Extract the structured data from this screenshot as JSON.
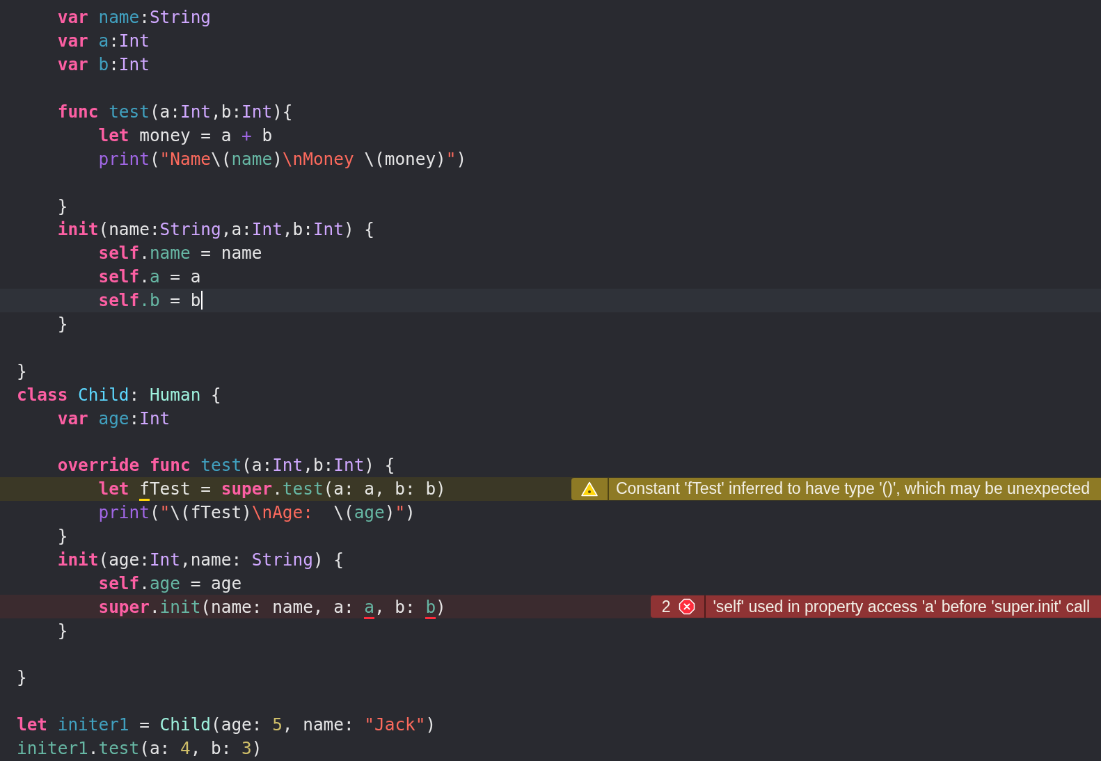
{
  "editor": {
    "lines": [
      {
        "kind": "code",
        "tokens": [
          {
            "text": "    var ",
            "kind": "keyword"
          },
          {
            "text": "name",
            "kind": "decl"
          },
          {
            "text": ":",
            "kind": "plain"
          },
          {
            "text": "String",
            "kind": "type"
          }
        ]
      },
      {
        "kind": "code",
        "tokens": [
          {
            "text": "    var ",
            "kind": "keyword"
          },
          {
            "text": "a",
            "kind": "decl"
          },
          {
            "text": ":",
            "kind": "plain"
          },
          {
            "text": "Int",
            "kind": "type"
          }
        ]
      },
      {
        "kind": "code",
        "tokens": [
          {
            "text": "    var ",
            "kind": "keyword"
          },
          {
            "text": "b",
            "kind": "decl"
          },
          {
            "text": ":",
            "kind": "plain"
          },
          {
            "text": "Int",
            "kind": "type"
          }
        ]
      },
      {
        "kind": "blank"
      },
      {
        "kind": "code",
        "tokens": [
          {
            "text": "    func ",
            "kind": "keyword"
          },
          {
            "text": "test",
            "kind": "decl"
          },
          {
            "text": "(a:",
            "kind": "plain"
          },
          {
            "text": "Int",
            "kind": "type"
          },
          {
            "text": ",b:",
            "kind": "plain"
          },
          {
            "text": "Int",
            "kind": "type"
          },
          {
            "text": "){",
            "kind": "plain"
          }
        ]
      },
      {
        "kind": "code",
        "tokens": [
          {
            "text": "        let",
            "kind": "keyword"
          },
          {
            "text": " money = a ",
            "kind": "plain"
          },
          {
            "text": "+",
            "kind": "operator"
          },
          {
            "text": " b",
            "kind": "plain"
          }
        ]
      },
      {
        "kind": "code",
        "tokens": [
          {
            "text": "        print",
            "kind": "sysfunc"
          },
          {
            "text": "(",
            "kind": "plain"
          },
          {
            "text": "\"Name",
            "kind": "string"
          },
          {
            "text": "\\(",
            "kind": "plain"
          },
          {
            "text": "name",
            "kind": "member"
          },
          {
            "text": ")",
            "kind": "plain"
          },
          {
            "text": "\\nMoney ",
            "kind": "string"
          },
          {
            "text": "\\(money)",
            "kind": "plain"
          },
          {
            "text": "\"",
            "kind": "string"
          },
          {
            "text": ")",
            "kind": "plain"
          }
        ]
      },
      {
        "kind": "blank"
      },
      {
        "kind": "code",
        "tokens": [
          {
            "text": "    }",
            "kind": "plain"
          }
        ]
      },
      {
        "kind": "code",
        "tokens": [
          {
            "text": "    init",
            "kind": "keyword"
          },
          {
            "text": "(name:",
            "kind": "plain"
          },
          {
            "text": "String",
            "kind": "type"
          },
          {
            "text": ",a:",
            "kind": "plain"
          },
          {
            "text": "Int",
            "kind": "type"
          },
          {
            "text": ",b:",
            "kind": "plain"
          },
          {
            "text": "Int",
            "kind": "type"
          },
          {
            "text": ") {",
            "kind": "plain"
          }
        ]
      },
      {
        "kind": "code",
        "tokens": [
          {
            "text": "        self",
            "kind": "keyword"
          },
          {
            "text": ".",
            "kind": "plain"
          },
          {
            "text": "name",
            "kind": "member"
          },
          {
            "text": " = name",
            "kind": "plain"
          }
        ]
      },
      {
        "kind": "code",
        "tokens": [
          {
            "text": "        self",
            "kind": "keyword"
          },
          {
            "text": ".",
            "kind": "plain"
          },
          {
            "text": "a",
            "kind": "member"
          },
          {
            "text": " = a",
            "kind": "plain"
          }
        ]
      },
      {
        "kind": "current",
        "cursor": true,
        "tokens": [
          {
            "text": "        self",
            "kind": "keyword"
          },
          {
            "text": ".b",
            "kind": "member"
          },
          {
            "text": " = b",
            "kind": "plain"
          }
        ]
      },
      {
        "kind": "code",
        "tokens": [
          {
            "text": "    }",
            "kind": "plain"
          }
        ]
      },
      {
        "kind": "blank"
      },
      {
        "kind": "code",
        "tokens": [
          {
            "text": "}",
            "kind": "plain"
          }
        ]
      },
      {
        "kind": "code",
        "tokens": [
          {
            "text": "class ",
            "kind": "keyword"
          },
          {
            "text": "Child",
            "kind": "classdecl"
          },
          {
            "text": ": ",
            "kind": "plain"
          },
          {
            "text": "Human",
            "kind": "projtype"
          },
          {
            "text": " {",
            "kind": "plain"
          }
        ]
      },
      {
        "kind": "code",
        "tokens": [
          {
            "text": "    var ",
            "kind": "keyword"
          },
          {
            "text": "age",
            "kind": "decl"
          },
          {
            "text": ":",
            "kind": "plain"
          },
          {
            "text": "Int",
            "kind": "type"
          }
        ]
      },
      {
        "kind": "blank"
      },
      {
        "kind": "code",
        "tokens": [
          {
            "text": "    override func ",
            "kind": "keyword"
          },
          {
            "text": "test",
            "kind": "decl"
          },
          {
            "text": "(a:",
            "kind": "plain"
          },
          {
            "text": "Int",
            "kind": "type"
          },
          {
            "text": ",b:",
            "kind": "plain"
          },
          {
            "text": "Int",
            "kind": "type"
          },
          {
            "text": ") {",
            "kind": "plain"
          }
        ]
      },
      {
        "kind": "warning",
        "issue": {
          "kind": "warning",
          "message": "Constant 'fTest' inferred to have type '()', which may be unexpected"
        },
        "tokens": [
          {
            "text": "        let ",
            "kind": "keyword"
          },
          {
            "text": "f",
            "kind": "plain",
            "underlined": true
          },
          {
            "text": "Test = ",
            "kind": "plain"
          },
          {
            "text": "super",
            "kind": "keyword"
          },
          {
            "text": ".",
            "kind": "plain"
          },
          {
            "text": "test",
            "kind": "member"
          },
          {
            "text": "(a: a, b: b)",
            "kind": "plain"
          }
        ]
      },
      {
        "kind": "code",
        "tokens": [
          {
            "text": "        print",
            "kind": "sysfunc"
          },
          {
            "text": "(",
            "kind": "plain"
          },
          {
            "text": "\"",
            "kind": "string"
          },
          {
            "text": "\\(fTest)",
            "kind": "plain"
          },
          {
            "text": "\\nAge:  ",
            "kind": "string"
          },
          {
            "text": "\\(",
            "kind": "plain"
          },
          {
            "text": "age",
            "kind": "member"
          },
          {
            "text": ")",
            "kind": "plain"
          },
          {
            "text": "\"",
            "kind": "string"
          },
          {
            "text": ")",
            "kind": "plain"
          }
        ]
      },
      {
        "kind": "code",
        "tokens": [
          {
            "text": "    }",
            "kind": "plain"
          }
        ]
      },
      {
        "kind": "code",
        "tokens": [
          {
            "text": "    init",
            "kind": "keyword"
          },
          {
            "text": "(age:",
            "kind": "plain"
          },
          {
            "text": "Int",
            "kind": "type"
          },
          {
            "text": ",name: ",
            "kind": "plain"
          },
          {
            "text": "String",
            "kind": "type"
          },
          {
            "text": ") {",
            "kind": "plain"
          }
        ]
      },
      {
        "kind": "code",
        "tokens": [
          {
            "text": "        self",
            "kind": "keyword"
          },
          {
            "text": ".",
            "kind": "plain"
          },
          {
            "text": "age",
            "kind": "member"
          },
          {
            "text": " = age",
            "kind": "plain"
          }
        ]
      },
      {
        "kind": "error",
        "issue": {
          "kind": "error",
          "count": "2",
          "message": "'self' used in property access 'a' before 'super.init' call"
        },
        "tokens": [
          {
            "text": "        super",
            "kind": "keyword"
          },
          {
            "text": ".",
            "kind": "plain"
          },
          {
            "text": "init",
            "kind": "member"
          },
          {
            "text": "(name: name, a: ",
            "kind": "plain"
          },
          {
            "text": "a",
            "kind": "member",
            "underlined": true
          },
          {
            "text": ", b: ",
            "kind": "plain"
          },
          {
            "text": "b",
            "kind": "member",
            "underlined": true
          },
          {
            "text": ")",
            "kind": "plain"
          }
        ]
      },
      {
        "kind": "code",
        "tokens": [
          {
            "text": "    }",
            "kind": "plain"
          }
        ]
      },
      {
        "kind": "blank"
      },
      {
        "kind": "code",
        "tokens": [
          {
            "text": "}",
            "kind": "plain"
          }
        ]
      },
      {
        "kind": "blank"
      },
      {
        "kind": "code",
        "tokens": [
          {
            "text": "let ",
            "kind": "keyword"
          },
          {
            "text": "initer1",
            "kind": "decl"
          },
          {
            "text": " = ",
            "kind": "plain"
          },
          {
            "text": "Child",
            "kind": "projtype"
          },
          {
            "text": "(age: ",
            "kind": "plain"
          },
          {
            "text": "5",
            "kind": "number"
          },
          {
            "text": ", name: ",
            "kind": "plain"
          },
          {
            "text": "\"Jack\"",
            "kind": "string"
          },
          {
            "text": ")",
            "kind": "plain"
          }
        ]
      },
      {
        "kind": "code",
        "tokens": [
          {
            "text": "initer1",
            "kind": "member"
          },
          {
            "text": ".",
            "kind": "plain"
          },
          {
            "text": "test",
            "kind": "member"
          },
          {
            "text": "(a: ",
            "kind": "plain"
          },
          {
            "text": "4",
            "kind": "number"
          },
          {
            "text": ", b: ",
            "kind": "plain"
          },
          {
            "text": "3",
            "kind": "number"
          },
          {
            "text": ")",
            "kind": "plain"
          }
        ]
      }
    ]
  }
}
